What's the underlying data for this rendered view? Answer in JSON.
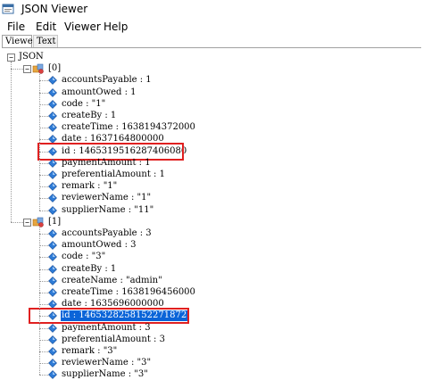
{
  "window": {
    "title": "JSON Viewer"
  },
  "menu": [
    "File",
    "Edit",
    "Viewer",
    "Help"
  ],
  "tabs": [
    {
      "label": "Viewer",
      "active": true
    },
    {
      "label": "Text",
      "active": false
    }
  ],
  "tree": {
    "root": "JSON",
    "items": [
      {
        "label": "[0]",
        "fields": [
          "accountsPayable : 1",
          "amountOwed : 1",
          "code : \"1\"",
          "createBy : 1",
          "createTime : 1638194372000",
          "date : 1637164800000",
          "id : 1465319516287406080",
          "paymentAmount : 1",
          "preferentialAmount : 1",
          "remark : \"1\"",
          "reviewerName : \"1\"",
          "supplierName : \"11\""
        ]
      },
      {
        "label": "[1]",
        "fields": [
          "accountsPayable : 3",
          "amountOwed : 3",
          "code : \"3\"",
          "createBy : 1",
          "createName : \"admin\"",
          "createTime : 1638196456000",
          "date : 1635696000000",
          "id : 1465328258152271872",
          "paymentAmount : 3",
          "preferentialAmount : 3",
          "remark : \"3\"",
          "reviewerName : \"3\"",
          "supplierName : \"3\""
        ]
      }
    ]
  },
  "colors": {
    "highlight_box": "#e02020",
    "selection": "#0a64d8"
  },
  "icons": {
    "app": "json-viewer-app-icon",
    "object": "object-node-icon",
    "value": "value-node-icon"
  }
}
